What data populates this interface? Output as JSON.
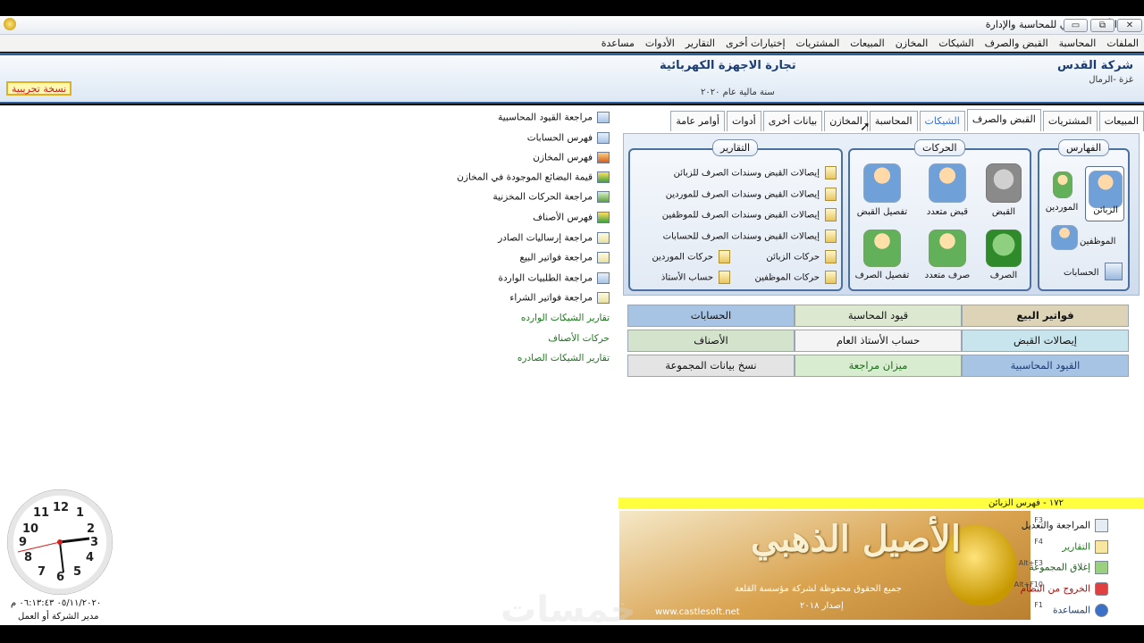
{
  "window": {
    "title": "الأصيل الذهبي للمحاسبة والإدارة",
    "min": "▭",
    "max": "⧉",
    "close": "✕"
  },
  "menu": [
    "الملفات",
    "المحاسبة",
    "القبض والصرف",
    "الشيكات",
    "المخازن",
    "المبيعات",
    "المشتريات",
    "إختيارات أخرى",
    "التقارير",
    "الأدوات",
    "مساعدة"
  ],
  "header": {
    "company": "شركة القدس",
    "branch": "غزة -الرمال",
    "activity": "تجارة الاجهزة الكهربائية",
    "fiscal_year": "سنة مالية عام ٢٠٢٠",
    "trial_label": "نسخة تجريبية"
  },
  "left_links": [
    "مراجعة القيود المحاسبية",
    "فهرس الحسابات",
    "فهرس المخازن",
    "قيمة البضائع الموجودة في المخازن",
    "مراجعة الحركات المخزنية",
    "فهرس الأصناف",
    "مراجعة إرساليات الصادر",
    "مراجعة فواتير البيع",
    "مراجعة الطلبيات الواردة",
    "مراجعة فواتير الشراء"
  ],
  "left_green_links": [
    "تقارير الشيكات الوارده",
    "حركات الأصناف",
    "تقارير الشيكات الصادره"
  ],
  "tabs": [
    "المبيعات",
    "المشتريات",
    "القبض والصرف",
    "الشيكات",
    "المحاسبة",
    "المخازن",
    "بيانات أخرى",
    "أدوات",
    "أوامر عامة"
  ],
  "groups": {
    "indexes": {
      "title": "الفهارس",
      "items": [
        "الزبائن",
        "الموردين",
        "الموظفين",
        "الحسابات"
      ]
    },
    "movements": {
      "title": "الحركات",
      "items": [
        "القبض",
        "قبض متعدد",
        "تفصيل القبض",
        "الصرف",
        "صرف متعدد",
        "تفصيل الصرف"
      ]
    },
    "reports": {
      "title": "التقارير",
      "items": [
        "إيصالات القبض وسندات الصرف للزبائن",
        "إيصالات القبض وسندات الصرف للموردين",
        "إيصالات القبض وسندات الصرف للموظفين",
        "إيصالات القبض وسندات الصرف للحسابات",
        "حركات الزبائن",
        "حركات الموردين",
        "حركات الموظفين",
        "حساب الأستاذ"
      ]
    }
  },
  "quick_grid": [
    [
      "فواتير البيع",
      "قيود المحاسبة",
      "الحسابات"
    ],
    [
      "إيصالات القبض",
      "حساب الأستاذ العام",
      "الأصناف"
    ],
    [
      "القيود المحاسبية",
      "ميزان مراجعة",
      "نسخ بيانات المجموعة"
    ]
  ],
  "status": "١٧٢ - فهرس الزبائن",
  "banner": {
    "logo": "الأصيل الذهبي",
    "copyright": "جميع الحقوق محفوظة لشركة مؤسسة القلعة",
    "version": "إصدار ٢٠١٨",
    "website": "www.castlesoft.net"
  },
  "commands": [
    {
      "label": "المراجعة والتعديل",
      "key": "F3"
    },
    {
      "label": "التقارير",
      "key": "F4"
    },
    {
      "label": "إغلاق المجموعة",
      "key": "Alt+F3"
    },
    {
      "label": "الخروج من النظام",
      "key": "Alt+F10"
    },
    {
      "label": "المساعدة",
      "key": "F1"
    }
  ],
  "clock": {
    "numbers": [
      "12",
      "1",
      "2",
      "3",
      "4",
      "5",
      "6",
      "7",
      "8",
      "9",
      "10",
      "11"
    ],
    "datetime": "٠٥/١١/٢٠٢٠ ٠٦:١٣:٤٣ م",
    "user": "مدير الشركة أو العمل"
  },
  "watermark": "خمسات"
}
